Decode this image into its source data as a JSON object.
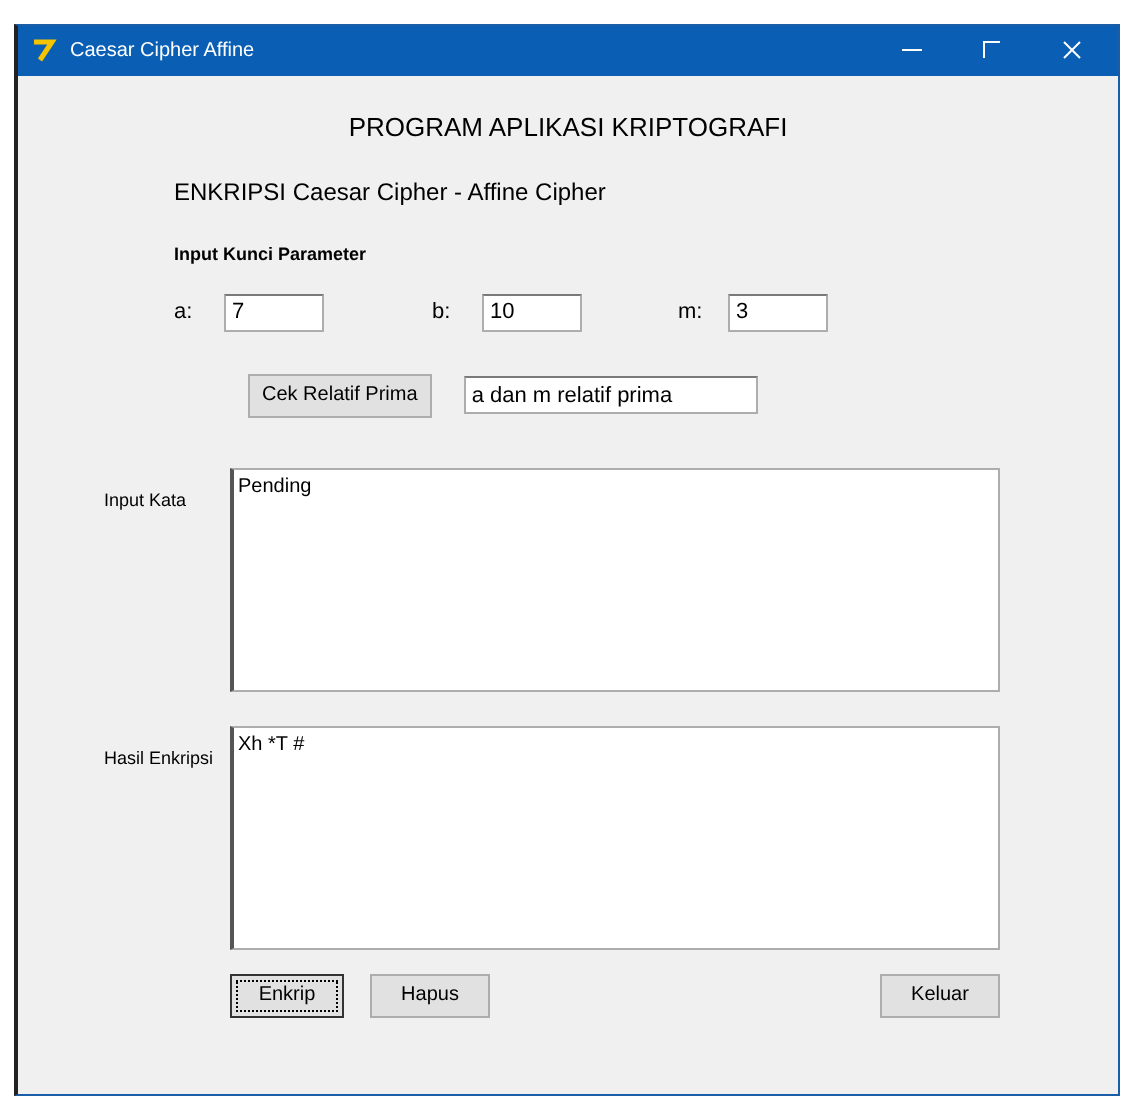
{
  "window": {
    "title": "Caesar Cipher Affine"
  },
  "heading": "PROGRAM APLIKASI KRIPTOGRAFI",
  "subheading": "ENKRIPSI Caesar Cipher - Affine Cipher",
  "params_label": "Input Kunci Parameter",
  "params": [
    {
      "label": "a:",
      "value": "7"
    },
    {
      "label": "b:",
      "value": "10"
    },
    {
      "label": "m:",
      "value": "3"
    }
  ],
  "check_button": "Cek Relatif Prima",
  "check_result": "a dan m relatif prima",
  "input_text": {
    "label": "Input Kata",
    "value": "Pending"
  },
  "output_text": {
    "label": "Hasil Enkripsi",
    "value": "Xh *T #"
  },
  "buttons": [
    {
      "label": "Enkrip",
      "focused": true
    },
    {
      "label": "Hapus",
      "focused": false
    },
    {
      "label": "Keluar",
      "focused": false
    }
  ]
}
